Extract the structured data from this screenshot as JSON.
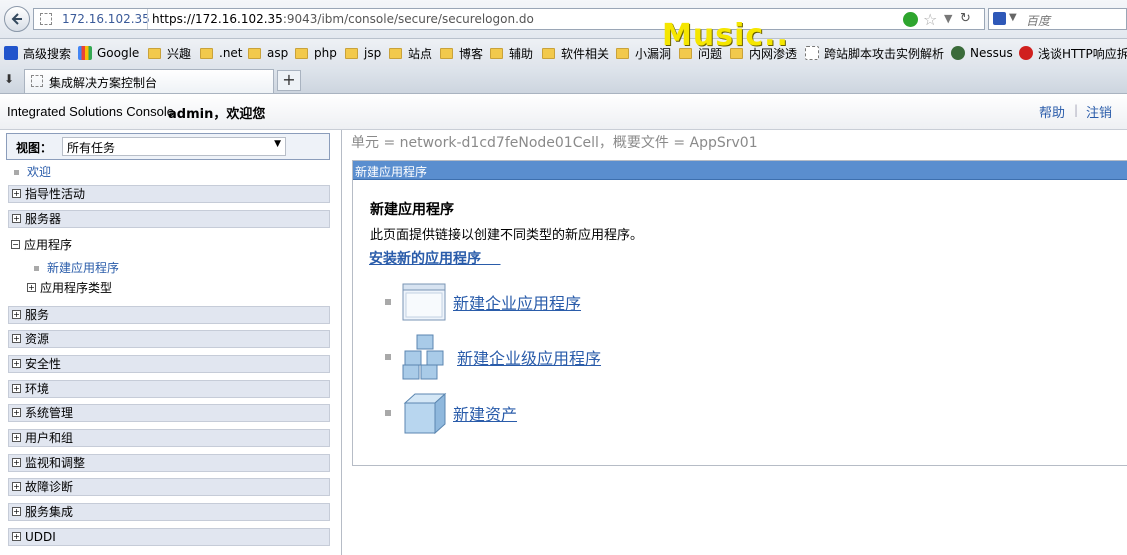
{
  "browser": {
    "host": "172.16.102.35",
    "url_host": "https://172.16.102.35",
    "url_path": ":9043/ibm/console/secure/securelogon.do",
    "search_placeholder": "百度",
    "bookmarks": [
      {
        "label": "高级搜索",
        "icon": "baidu-paw-icon"
      },
      {
        "label": "Google",
        "icon": "google-icon"
      },
      {
        "label": "兴趣",
        "icon": "folder-icon"
      },
      {
        "label": ".net",
        "icon": "folder-icon"
      },
      {
        "label": "asp",
        "icon": "folder-icon"
      },
      {
        "label": "php",
        "icon": "folder-icon"
      },
      {
        "label": "jsp",
        "icon": "folder-icon"
      },
      {
        "label": "站点",
        "icon": "folder-icon"
      },
      {
        "label": "博客",
        "icon": "folder-icon"
      },
      {
        "label": "辅助",
        "icon": "folder-icon"
      },
      {
        "label": "软件相关",
        "icon": "folder-icon"
      },
      {
        "label": "小漏洞",
        "icon": "folder-icon"
      },
      {
        "label": "问题",
        "icon": "folder-icon"
      },
      {
        "label": "内网渗透",
        "icon": "folder-icon"
      },
      {
        "label": "跨站脚本攻击实例解析",
        "icon": "page-icon"
      },
      {
        "label": "Nessus",
        "icon": "nessus-icon"
      },
      {
        "label": "浅谈HTTP响应拆",
        "icon": "zdnet-icon"
      }
    ],
    "overlay_text": "Music..",
    "tab_title": "集成解决方案控制台",
    "new_tab": "+"
  },
  "header": {
    "product": "Integrated Solutions Console",
    "user": "admin，欢迎您",
    "help": "帮助",
    "separator": "|",
    "logout": "注销"
  },
  "nav": {
    "view_label": "视图：",
    "view_value": "所有任务",
    "welcome": "欢迎",
    "items": [
      {
        "label": "指导性活动",
        "expanded": false
      },
      {
        "label": "服务器",
        "expanded": false
      },
      {
        "label": "应用程序",
        "expanded": true
      },
      {
        "label": "新建应用程序",
        "sub": true
      },
      {
        "label": "应用程序类型",
        "sub": true
      },
      {
        "label": "服务",
        "expanded": false
      },
      {
        "label": "资源",
        "expanded": false
      },
      {
        "label": "安全性",
        "expanded": false
      },
      {
        "label": "环境",
        "expanded": false
      },
      {
        "label": "系统管理",
        "expanded": false
      },
      {
        "label": "用户和组",
        "expanded": false
      },
      {
        "label": "监视和调整",
        "expanded": false
      },
      {
        "label": "故障诊断",
        "expanded": false
      },
      {
        "label": "服务集成",
        "expanded": false
      },
      {
        "label": "UDDI",
        "expanded": false
      }
    ]
  },
  "content": {
    "scope": "单元 = network-d1cd7feNode01Cell，概要文件 = AppSrv01",
    "panel_title": "新建应用程序",
    "heading": "新建应用程序",
    "description": "此页面提供链接以创建不同类型的新应用程序。",
    "install_link": "安装新的应用程序",
    "links": [
      {
        "label": "新建企业应用程序",
        "icon": "enterprise-app-window-icon"
      },
      {
        "label": "新建企业级应用程序",
        "icon": "business-level-app-cubes-icon"
      },
      {
        "label": "新建资产",
        "icon": "asset-cube-icon"
      }
    ]
  },
  "colors": {
    "link": "#2a5caa",
    "panel_header": "#5a8ecf",
    "nav_row": "#e1e6f0"
  }
}
